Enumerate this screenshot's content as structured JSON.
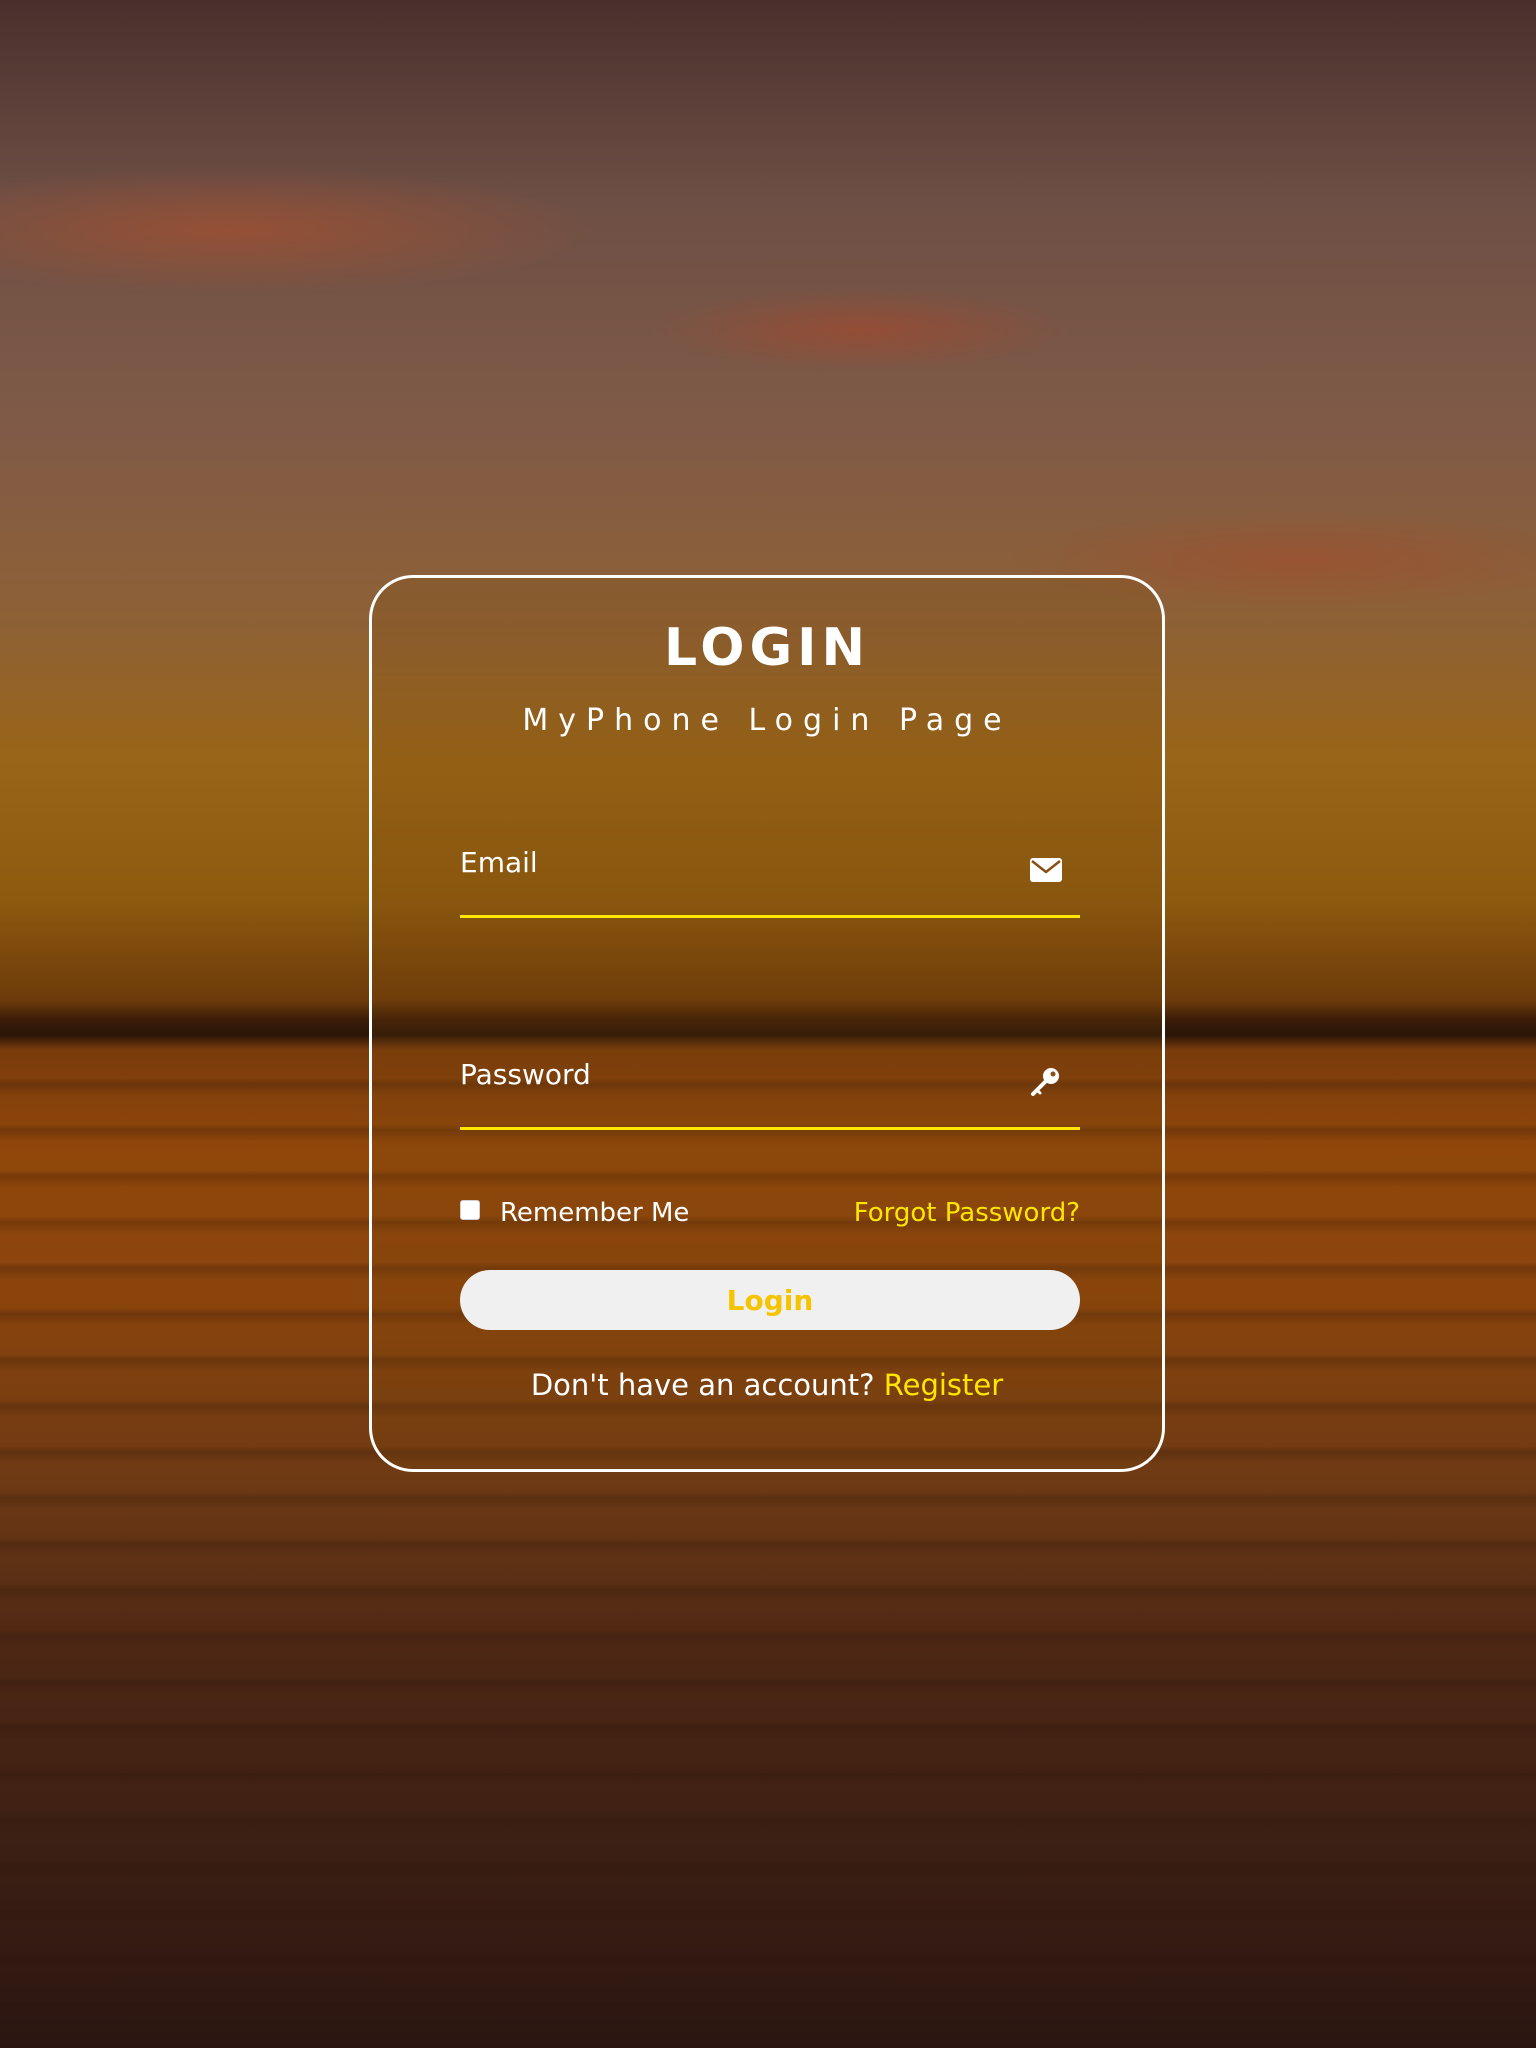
{
  "login_card": {
    "title": "LOGIN",
    "subtitle": "MyPhone Login Page",
    "email": {
      "label": "Email",
      "value": "",
      "icon": "envelope-icon"
    },
    "password": {
      "label": "Password",
      "value": "",
      "icon": "key-icon"
    },
    "remember_me": {
      "label": "Remember Me",
      "checked": false
    },
    "forgot_password_label": "Forgot Password?",
    "login_button_label": "Login",
    "register_prompt": "Don't have an account?",
    "register_link_label": "Register"
  },
  "colors": {
    "accent_yellow": "#ffe600",
    "button_text": "#f5c400",
    "button_bg": "#f0f0f0",
    "card_border": "#ffffff"
  }
}
